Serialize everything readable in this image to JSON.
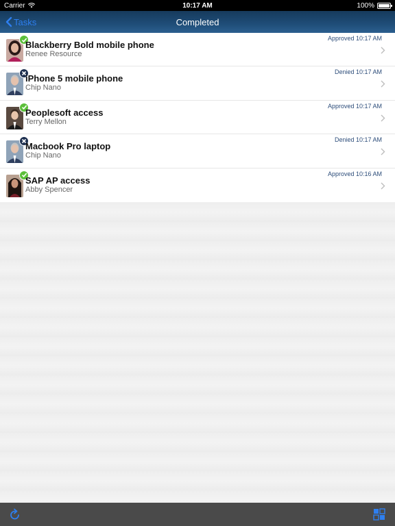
{
  "status_bar": {
    "carrier": "Carrier",
    "time": "10:17 AM",
    "battery": "100%"
  },
  "nav": {
    "back_label": "Tasks",
    "title": "Completed"
  },
  "items": [
    {
      "title": "Blackberry Bold mobile phone",
      "subtitle": "Renee Resource",
      "status": "Approved 10:17 AM",
      "result": "approved",
      "avatar": "woman-dark-hair"
    },
    {
      "title": "iPhone 5 mobile phone",
      "subtitle": "Chip  Nano",
      "status": "Denied 10:17 AM",
      "result": "denied",
      "avatar": "man-gray-hair"
    },
    {
      "title": "Peoplesoft access",
      "subtitle": "Terry  Mellon",
      "status": "Approved 10:17 AM",
      "result": "approved",
      "avatar": "man-dark-suit"
    },
    {
      "title": "Macbook Pro laptop",
      "subtitle": "Chip  Nano",
      "status": "Denied 10:17 AM",
      "result": "denied",
      "avatar": "man-gray-hair"
    },
    {
      "title": "SAP AP access",
      "subtitle": "Abby  Spencer",
      "status": "Approved 10:16 AM",
      "result": "approved",
      "avatar": "woman-long-hair"
    }
  ],
  "colors": {
    "accent": "#2e7ff0",
    "approved": "#5bbf3a",
    "denied": "#1e3050",
    "status_text": "#2d4d7a"
  },
  "icons": {
    "back": "chevron-left-icon",
    "refresh": "refresh-icon",
    "grid": "grid-icon",
    "approved_badge": "checkmark-icon",
    "denied_badge": "x-icon"
  }
}
